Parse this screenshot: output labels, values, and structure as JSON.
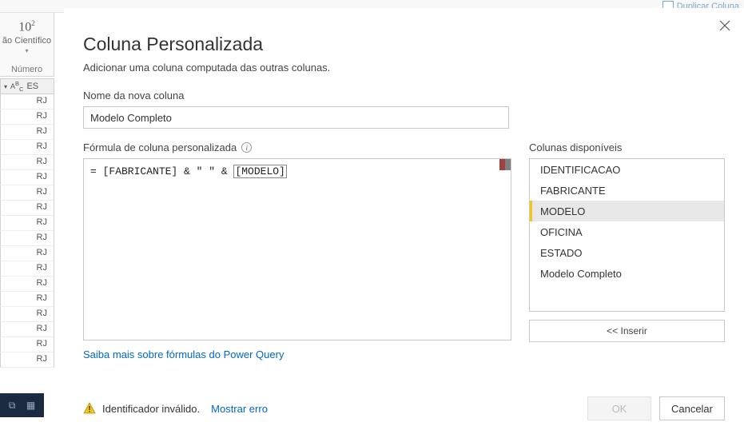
{
  "ribbon": {
    "duplicate_label": "Duplicar Coluna",
    "scientific_symbol": "10",
    "scientific_label_left": "ão",
    "scientific_label_right": "Científico",
    "group_label": "Número",
    "grid_header": "ES",
    "cell_value": "RJ"
  },
  "dialog": {
    "title": "Coluna Personalizada",
    "subtitle": "Adicionar uma coluna computada das outras colunas.",
    "new_column_label": "Nome da nova coluna",
    "new_column_value": "Modelo Completo",
    "formula_label": "Fórmula de coluna personalizada",
    "formula_prefix": "= [FABRICANTE] & \" \" & ",
    "formula_err": "[MODELO]",
    "available_columns_label": "Colunas disponíveis",
    "columns": [
      {
        "label": "IDENTIFICACAO",
        "selected": false
      },
      {
        "label": "FABRICANTE",
        "selected": false
      },
      {
        "label": "MODELO",
        "selected": true
      },
      {
        "label": "OFICINA",
        "selected": false
      },
      {
        "label": "ESTADO",
        "selected": false
      },
      {
        "label": "Modelo Completo",
        "selected": false
      }
    ],
    "insert_label": "<< Inserir",
    "learn_more": "Saiba mais sobre fórmulas do Power Query",
    "status_text": "Identificador inválido.",
    "show_error": "Mostrar erro",
    "ok_label": "OK",
    "cancel_label": "Cancelar"
  }
}
